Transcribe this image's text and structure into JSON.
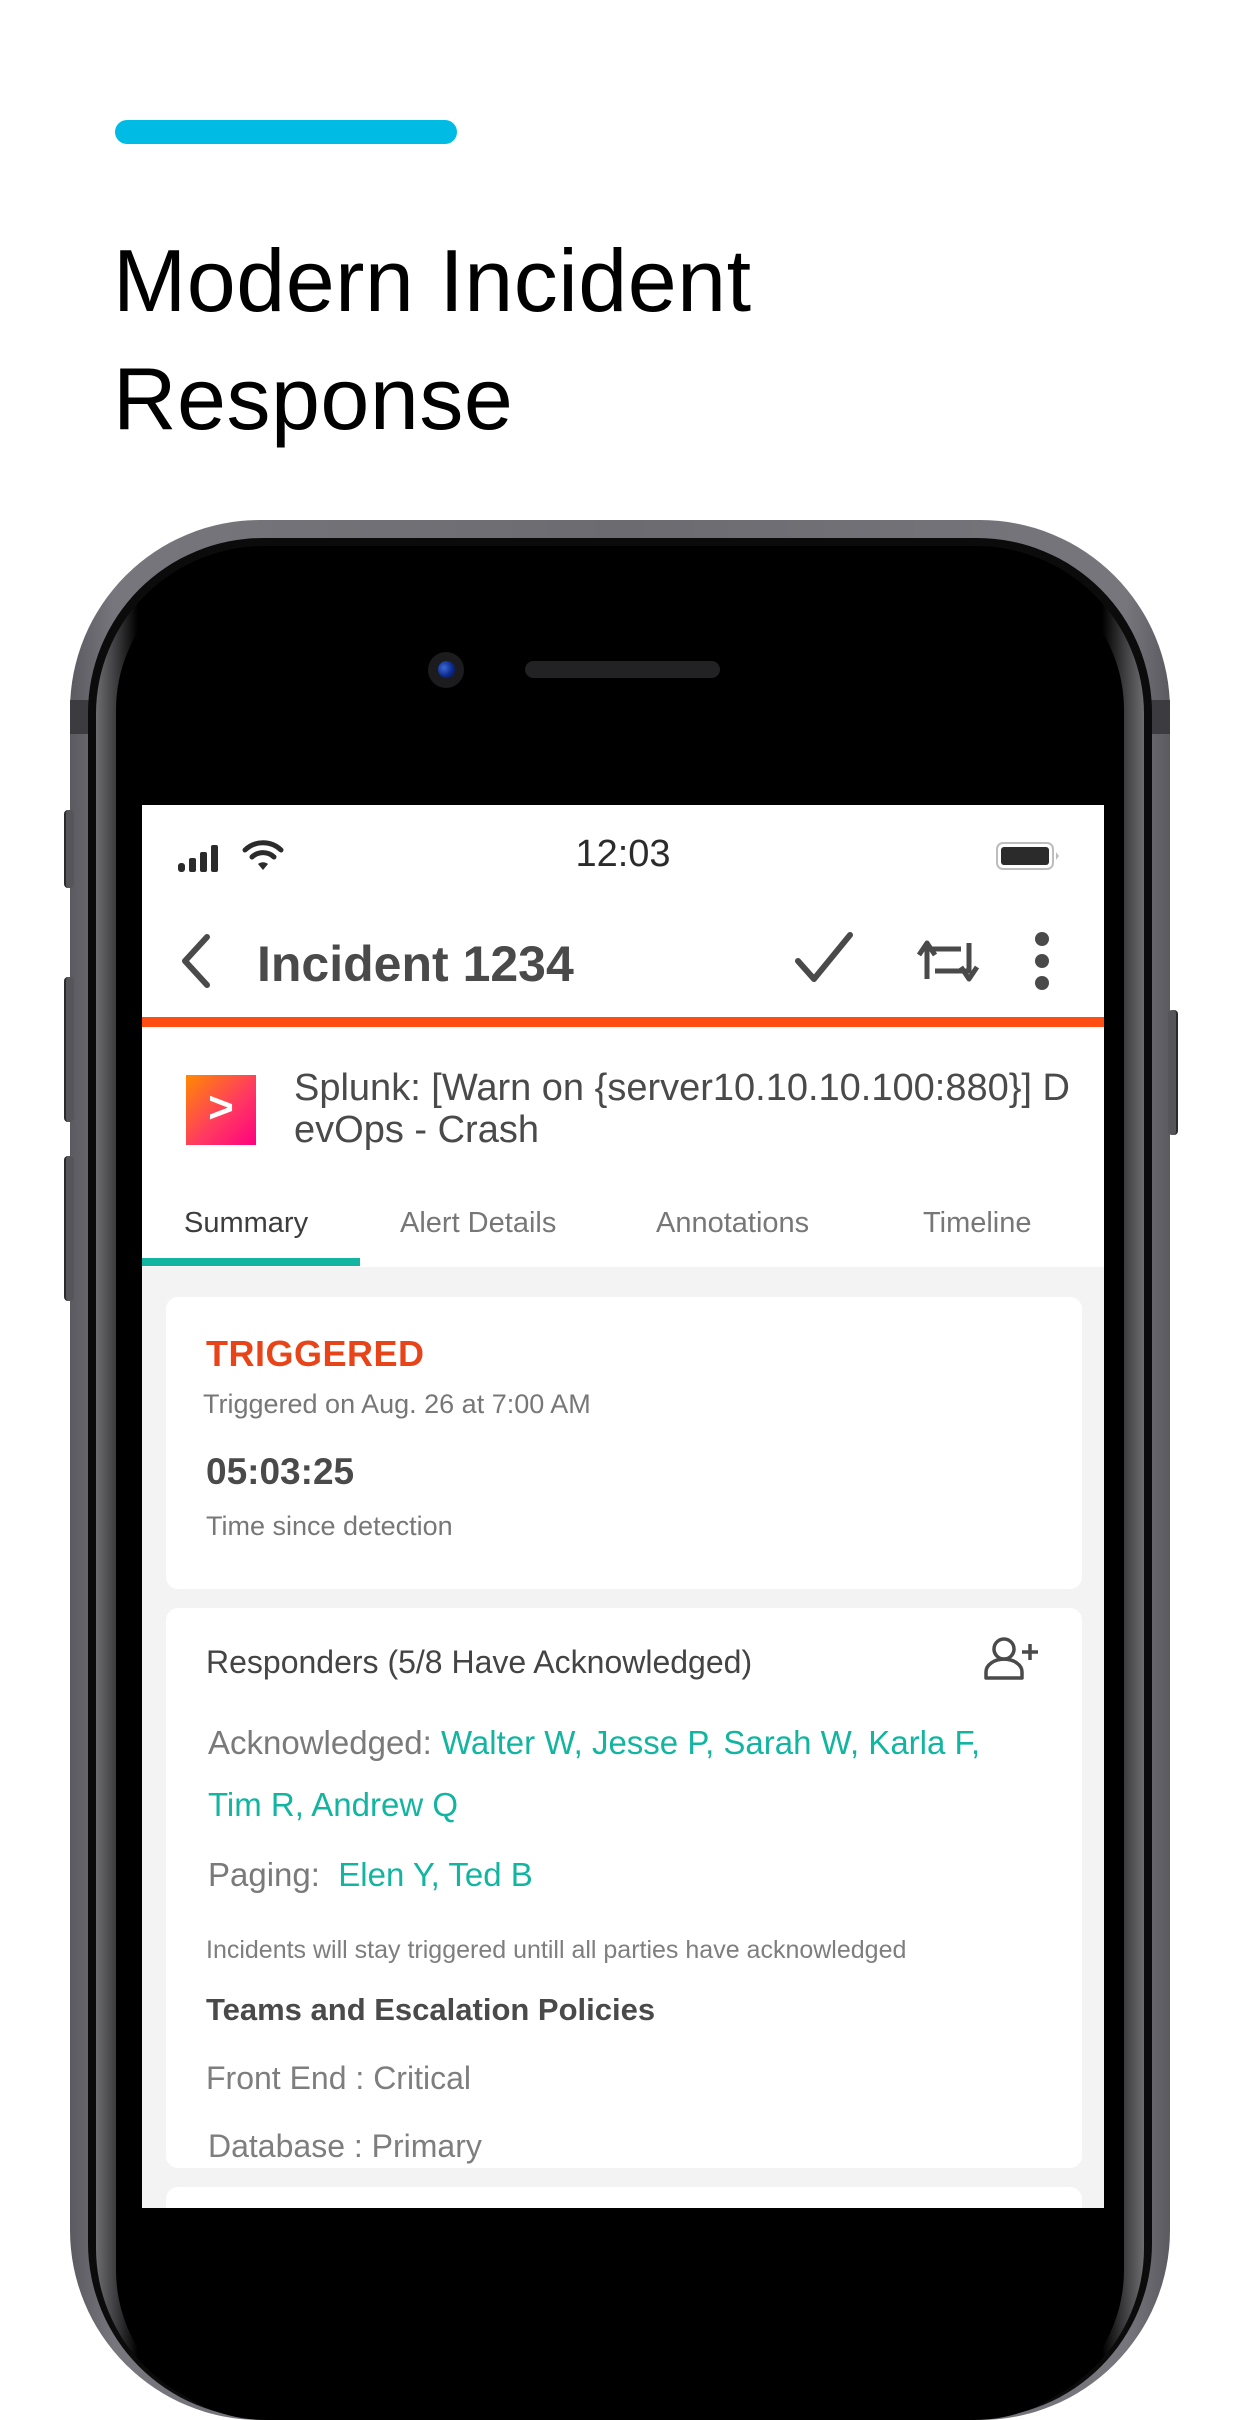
{
  "hero": {
    "title_line1": "Modern Incident",
    "title_line2": "Response",
    "accent_color": "#00bce4"
  },
  "status_bar": {
    "time": "12:03",
    "icons": [
      "signal-icon",
      "wifi-icon",
      "battery-icon"
    ]
  },
  "app_bar": {
    "title": "Incident 1234",
    "back_icon": "chevron-left-icon",
    "actions": [
      {
        "name": "acknowledge",
        "icon": "check-icon"
      },
      {
        "name": "reassign",
        "icon": "reassign-icon"
      },
      {
        "name": "more",
        "icon": "more-vertical-icon"
      }
    ],
    "urgency_color": "#ff4d14"
  },
  "incident": {
    "source_logo": ">",
    "summary": "Splunk: [Warn on {server10.10.10.100:880}] DevOps - Crash"
  },
  "tabs": [
    {
      "label": "Summary",
      "active": true
    },
    {
      "label": "Alert Details",
      "active": false
    },
    {
      "label": "Annotations",
      "active": false
    },
    {
      "label": "Timeline",
      "active": false
    }
  ],
  "status_card": {
    "status": "TRIGGERED",
    "status_color": "#e8441a",
    "triggered_on": "Triggered on Aug. 26 at 7:00 AM",
    "elapsed": "05:03:25",
    "elapsed_label": "Time since detection"
  },
  "responders_card": {
    "title": "Responders (5/8 Have Acknowledged)",
    "acknowledged_label": "Acknowledged:",
    "acknowledged_names": "Walter W, Jesse P, Sarah W, Karla F, Tim R, Andrew Q",
    "paging_label": "Paging:",
    "paging_names": "Elen Y, Ted B",
    "note": "Incidents will stay triggered untill all parties have acknowledged",
    "teams_title": "Teams and Escalation Policies",
    "policies": [
      {
        "text": "Front End : Critical"
      },
      {
        "text": "Database : Primary"
      }
    ],
    "link_color": "#13b5a1"
  }
}
